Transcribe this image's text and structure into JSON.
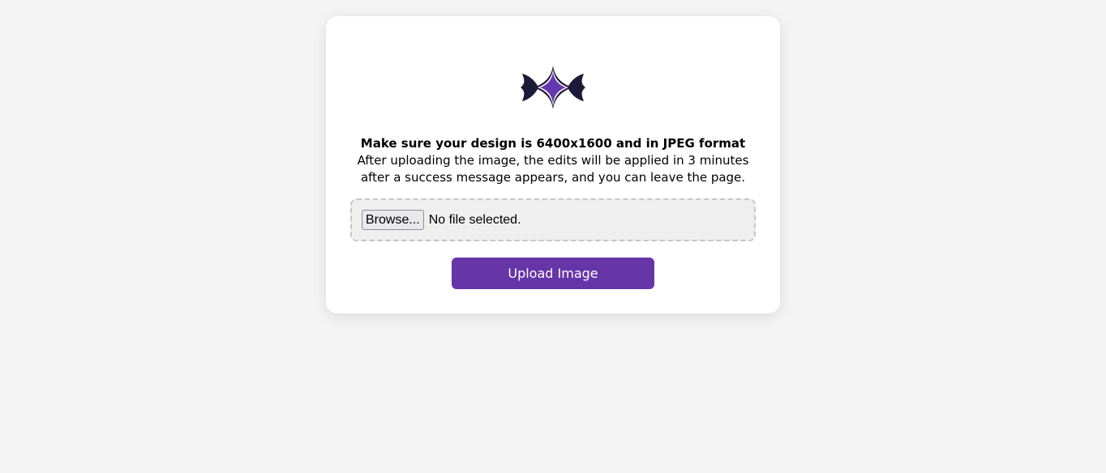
{
  "logo": {
    "icon": "sparkle-logo-icon",
    "colors": {
      "outer": "#1c1a36",
      "inner": "#6638b0"
    }
  },
  "instructions": {
    "headline": "Make sure your design is 6400x1600 and in JPEG format",
    "description": "After uploading the image, the edits will be applied in 3 minutes after a success message appears, and you can leave the page."
  },
  "file_input": {
    "browse_label": "Browse...",
    "status": "No file selected."
  },
  "upload_button": {
    "label": "Upload Image",
    "color": "#6635a8"
  }
}
